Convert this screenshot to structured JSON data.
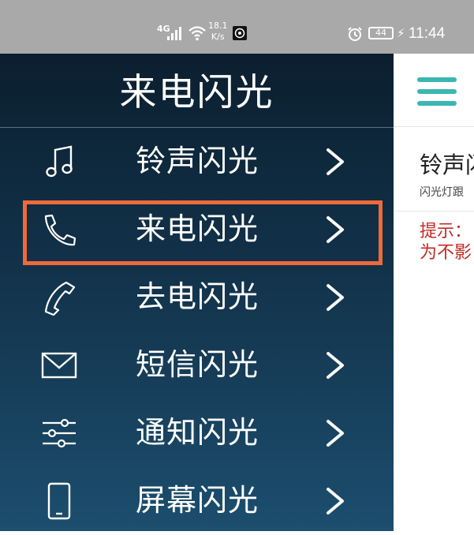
{
  "status_bar": {
    "network": "4G",
    "speed_value": "18.1",
    "speed_unit": "K/s",
    "battery": "44",
    "time": "11:44"
  },
  "drawer": {
    "title": "来电闪光",
    "items": [
      {
        "label": "铃声闪光",
        "icon": "music-note-icon"
      },
      {
        "label": "来电闪光",
        "icon": "phone-incoming-icon",
        "highlighted": true
      },
      {
        "label": "去电闪光",
        "icon": "phone-outgoing-icon"
      },
      {
        "label": "短信闪光",
        "icon": "envelope-icon"
      },
      {
        "label": "通知闪光",
        "icon": "sliders-icon"
      },
      {
        "label": "屏幕闪光",
        "icon": "smartphone-icon"
      }
    ]
  },
  "content": {
    "card_title": "铃声闪",
    "card_subtitle": "闪光灯跟",
    "tip_line1": "提示：",
    "tip_line2": "为不影"
  },
  "colors": {
    "drawer_top": "#0b1f2f",
    "drawer_bottom": "#1c4e6e",
    "highlight_border": "#ef6a39",
    "accent_teal": "#3bb6b2",
    "tip_red": "#c32b25",
    "status_bar": "#a9a9a9"
  }
}
